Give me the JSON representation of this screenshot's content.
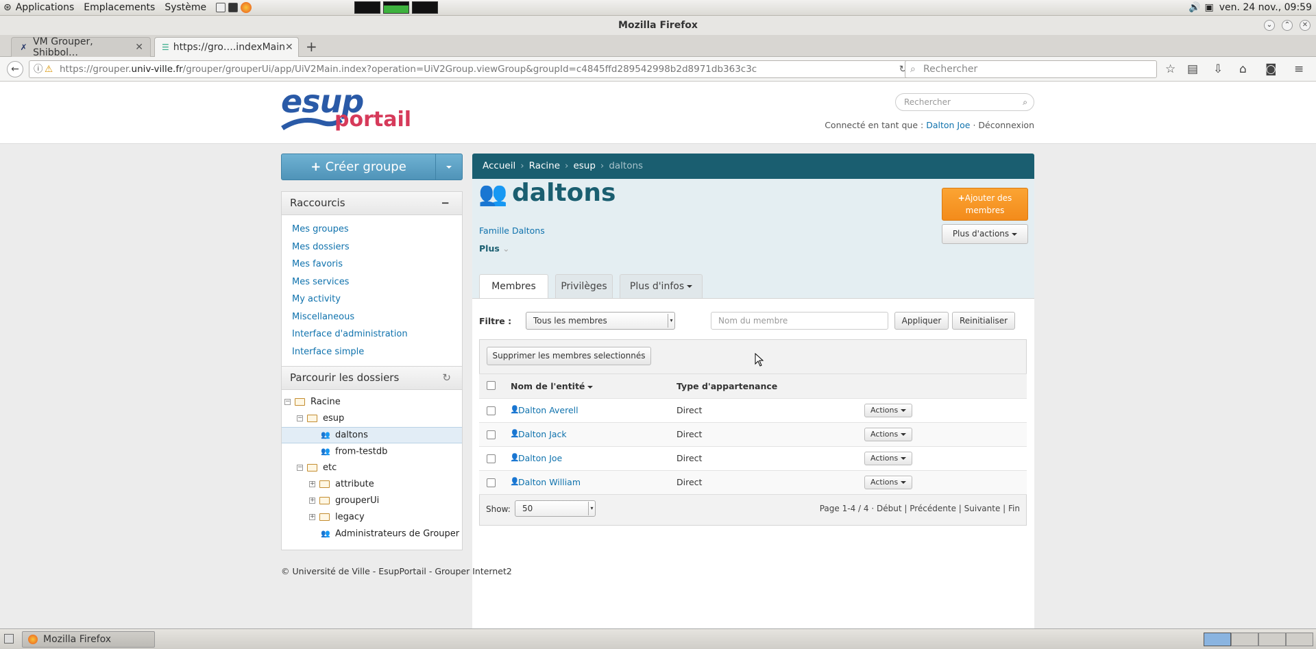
{
  "gnome": {
    "menus": [
      "Applications",
      "Emplacements",
      "Système"
    ],
    "clock": "ven. 24 nov., 09:59"
  },
  "firefox": {
    "window_title": "Mozilla Firefox",
    "tabs": [
      {
        "title": "VM Grouper, Shibbol…",
        "active": false
      },
      {
        "title": "https://gro….indexMain",
        "active": true
      }
    ],
    "url_prefix": "https://grouper.",
    "url_domain": "univ-ville.fr",
    "url_rest": "/grouper/grouperUi/app/UiV2Main.index?operation=UiV2Group.viewGroup&groupId=c4845ffd289542998b2d8971db363c3c",
    "search_placeholder": "Rechercher"
  },
  "header": {
    "logo_esup": "esup",
    "logo_portail": "portail",
    "search_placeholder": "Rechercher",
    "connected_label": "Connecté en tant que :",
    "user": "Dalton Joe",
    "logout": "Déconnexion"
  },
  "sidebar": {
    "create_button": "Créer groupe",
    "shortcuts_title": "Raccourcis",
    "shortcuts": [
      "Mes groupes",
      "Mes dossiers",
      "Mes favoris",
      "Mes services",
      "My activity",
      "Miscellaneous",
      "Interface d'administration",
      "Interface simple"
    ],
    "browse_title": "Parcourir les dossiers",
    "tree": [
      {
        "label": "Racine",
        "kind": "folder-open",
        "toggle": "−",
        "depth": 0
      },
      {
        "label": "esup",
        "kind": "folder-open",
        "toggle": "−",
        "depth": 1
      },
      {
        "label": "daltons",
        "kind": "group",
        "toggle": "",
        "depth": 2,
        "selected": true
      },
      {
        "label": "from-testdb",
        "kind": "group",
        "toggle": "",
        "depth": 2
      },
      {
        "label": "etc",
        "kind": "folder-open",
        "toggle": "−",
        "depth": 1
      },
      {
        "label": "attribute",
        "kind": "folder",
        "toggle": "+",
        "depth": 2
      },
      {
        "label": "grouperUi",
        "kind": "folder",
        "toggle": "+",
        "depth": 2
      },
      {
        "label": "legacy",
        "kind": "folder",
        "toggle": "+",
        "depth": 2
      },
      {
        "label": "Administrateurs de Grouper",
        "kind": "group",
        "toggle": "",
        "depth": 2
      }
    ]
  },
  "breadcrumb": [
    "Accueil",
    "Racine",
    "esup",
    "daltons"
  ],
  "group": {
    "name": "daltons",
    "description": "Famille Daltons",
    "more": "Plus",
    "add_members": "Ajouter des membres",
    "more_actions": "Plus d'actions"
  },
  "tabs": [
    "Membres",
    "Privilèges",
    "Plus d'infos"
  ],
  "filter": {
    "label": "Filtre :",
    "select_value": "Tous les membres",
    "member_placeholder": "Nom du membre",
    "apply": "Appliquer",
    "reset": "Reinitialiser"
  },
  "members": {
    "delete_selected": "Supprimer les membres selectionnés",
    "col_name": "Nom de l'entité",
    "col_type": "Type d'appartenance",
    "rows": [
      {
        "name": "Dalton Averell",
        "type": "Direct",
        "action": "Actions"
      },
      {
        "name": "Dalton Jack",
        "type": "Direct",
        "action": "Actions"
      },
      {
        "name": "Dalton Joe",
        "type": "Direct",
        "action": "Actions"
      },
      {
        "name": "Dalton William",
        "type": "Direct",
        "action": "Actions"
      }
    ],
    "show_label": "Show:",
    "show_value": "50",
    "pager": {
      "info": "Page 1-4 / 4",
      "first": "Début",
      "prev": "Précédente",
      "next": "Suivante",
      "last": "Fin"
    }
  },
  "footer": "© Université de Ville - EsupPortail - Grouper Internet2",
  "taskbar": {
    "item": "Mozilla Firefox"
  },
  "colors": {
    "teal": "#1a5e70",
    "accent": "#0f72ad",
    "orange": "#f38b1b",
    "logo_blue": "#2a5aa7",
    "logo_red": "#d63a5a"
  }
}
